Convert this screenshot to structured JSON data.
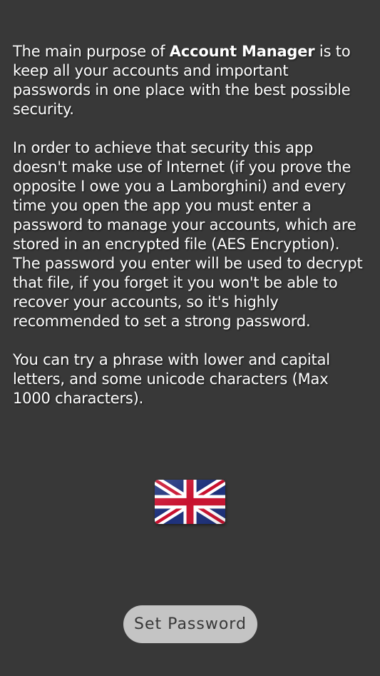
{
  "intro": {
    "p1_before": "The main purpose of ",
    "app_name": "Account Manager",
    "p1_after": " is to keep all your accounts and important passwords in one place with the best possible security.",
    "p2": "In order to achieve that security this app doesn't make use of Internet (if you prove the opposite I owe you a Lamborghini) and every time you open the app you must enter a password to manage your accounts, which are stored in an encrypted file (AES Encryption). The password you enter will be used to decrypt that file, if you forget it you won't be able to recover your accounts, so it's highly recommended to set a strong password.",
    "p3": "You can try a phrase with lower and capital letters, and some unicode characters (Max 1000 characters)."
  },
  "language": {
    "icon": "uk-flag-icon"
  },
  "actions": {
    "set_password_label": "Set Password"
  },
  "colors": {
    "background": "#383838",
    "text": "#ffffff",
    "button_bg": "#c4c4c4",
    "button_text": "#383838"
  }
}
